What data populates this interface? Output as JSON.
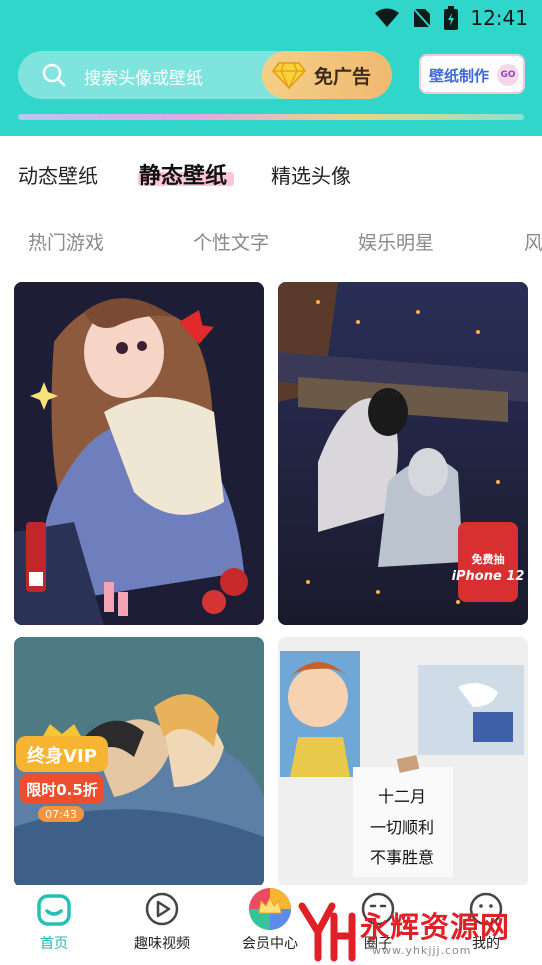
{
  "status": {
    "time": "12:41"
  },
  "header": {
    "search_placeholder": "搜索头像或壁纸",
    "no_ads_label": "免广告",
    "make_label": "壁纸制作",
    "make_go": "GO"
  },
  "tabs": [
    {
      "label": "动态壁纸"
    },
    {
      "label": "静态壁纸"
    },
    {
      "label": "精选头像"
    }
  ],
  "subtabs": [
    {
      "label": "热门游戏"
    },
    {
      "label": "个性文字"
    },
    {
      "label": "娱乐明星"
    },
    {
      "label": "风"
    }
  ],
  "cards": {
    "promo_line1": "免费抽",
    "promo_line2": "iPhone 12",
    "note_line1": "十二月",
    "note_line2": "一切顺利",
    "note_line3": "不事胜意"
  },
  "vip": {
    "title": "终身VIP",
    "discount": "限时0.5折",
    "countdown": "07:43"
  },
  "bottom_nav": [
    {
      "label": "首页"
    },
    {
      "label": "趣味视频"
    },
    {
      "label": "会员中心"
    },
    {
      "label": "圈子"
    },
    {
      "label": "我的"
    }
  ],
  "watermark": {
    "title": "永辉资源网",
    "url": "www.yhkjjj.com"
  },
  "colors": {
    "header_bg": "#2fd6c9",
    "accent": "#22b9b0",
    "watermark_red": "#e02027"
  }
}
